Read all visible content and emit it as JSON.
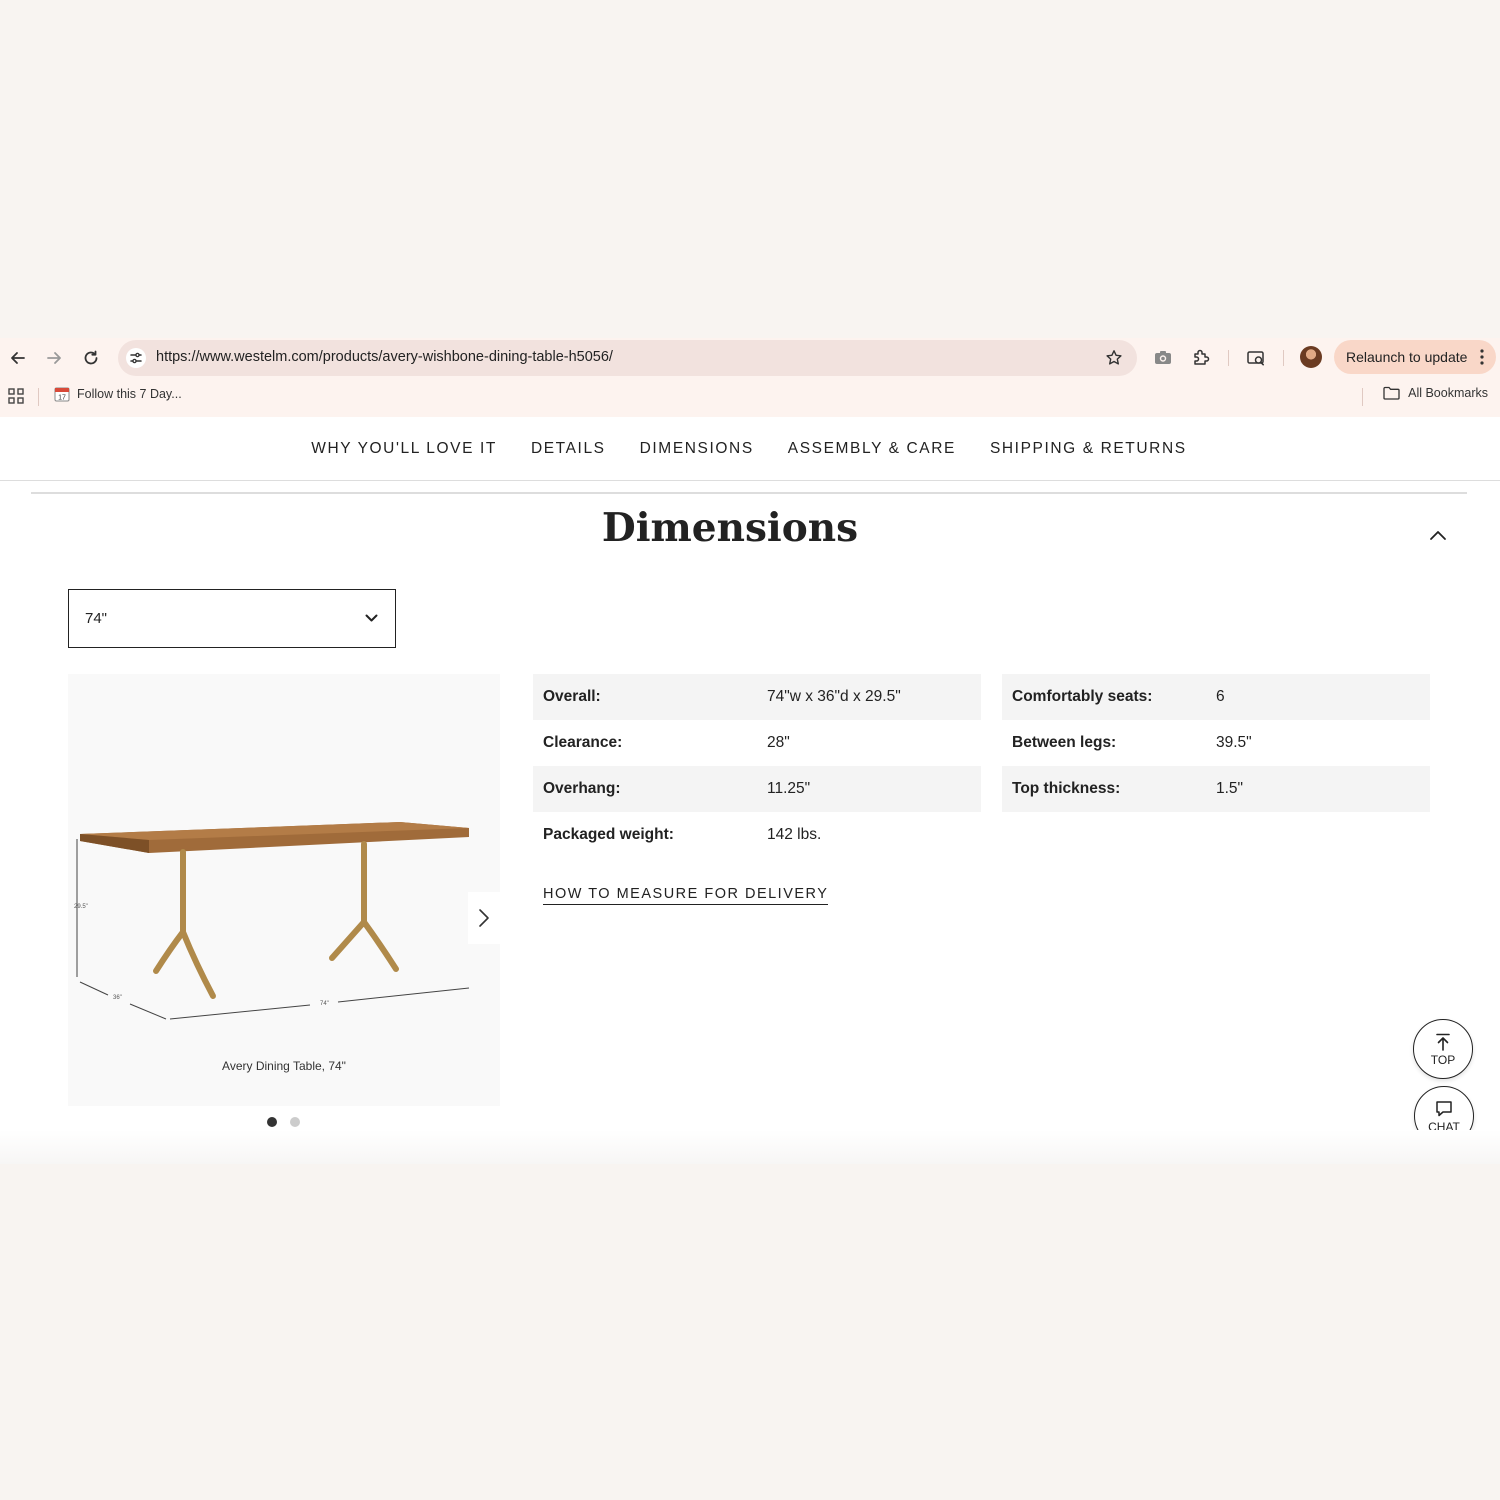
{
  "browser": {
    "url": "https://www.westelm.com/products/avery-wishbone-dining-table-h5056/",
    "relaunch_label": "Relaunch to update",
    "bookmark_item": "Follow this 7 Day...",
    "bookmark_calendar_day": "17",
    "all_bookmarks": "All Bookmarks"
  },
  "section_nav": [
    "WHY YOU'LL LOVE IT",
    "DETAILS",
    "DIMENSIONS",
    "ASSEMBLY & CARE",
    "SHIPPING & RETURNS"
  ],
  "dimensions": {
    "title": "Dimensions",
    "size_selected": "74\"",
    "image": {
      "caption": "Avery Dining Table, 74\"",
      "height_label": "29.5\"",
      "depth_label": "36\"",
      "width_label": "74\"",
      "carousel_count": 2,
      "carousel_active": 1
    },
    "specs_left": [
      {
        "label": "Overall:",
        "value": "74\"w x 36\"d x 29.5\""
      },
      {
        "label": "Clearance:",
        "value": "28\""
      },
      {
        "label": "Overhang:",
        "value": "11.25\""
      },
      {
        "label": "Packaged weight:",
        "value": "142 lbs."
      }
    ],
    "specs_right": [
      {
        "label": "Comfortably seats:",
        "value": "6"
      },
      {
        "label": "Between legs:",
        "value": "39.5\""
      },
      {
        "label": "Top thickness:",
        "value": "1.5\""
      }
    ],
    "measure_link": "HOW TO MEASURE FOR DELIVERY"
  },
  "floating": {
    "top_label": "TOP",
    "chat_label": "CHAT"
  },
  "colors": {
    "page_bg": "#f8f4f1",
    "chrome_bg": "#fdf3ef",
    "omnibox_bg": "#f2e2de",
    "relaunch_bg": "#f9d7c8",
    "row_shade": "#f4f4f4",
    "wood": "#9b6a3c",
    "brass": "#b08a4a"
  }
}
